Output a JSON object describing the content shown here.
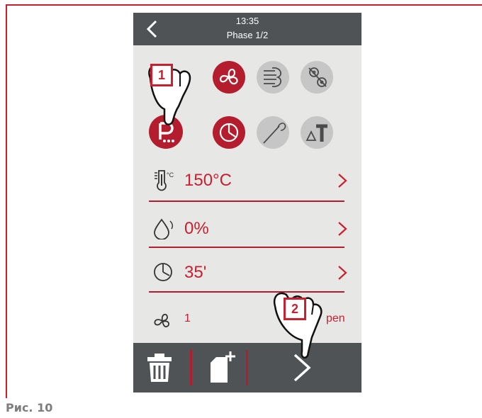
{
  "header": {
    "time": "13:35",
    "phase": "Phase 1/2"
  },
  "params": [
    {
      "value": "150°C",
      "icon": "thermometer-icon",
      "unit_label": "°C"
    },
    {
      "value": "0%",
      "icon": "humidity-drop-icon"
    },
    {
      "value": "35'",
      "icon": "clock-icon"
    }
  ],
  "fan": {
    "value": "1",
    "right_label": "pen"
  },
  "callouts": {
    "first": "1",
    "second": "2"
  },
  "figure": {
    "caption": "Рис. 10"
  },
  "colors": {
    "accent": "#b31d2e",
    "bar": "#4f5356",
    "panel": "#e7e7e5",
    "inactive": "#c6c6c6"
  }
}
